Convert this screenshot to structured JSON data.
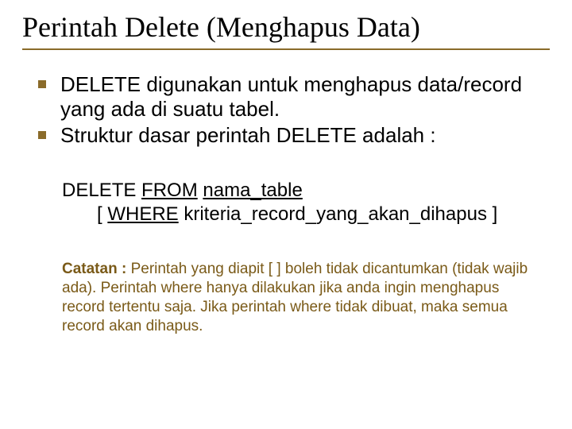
{
  "title": "Perintah Delete (Menghapus Data)",
  "bullets": [
    "DELETE digunakan untuk menghapus data/record yang ada di suatu tabel.",
    "Struktur dasar perintah DELETE adalah :"
  ],
  "syntax": {
    "kw_delete": "DELETE",
    "kw_from": "FROM",
    "table_placeholder": "nama_table",
    "bracket_open": "[",
    "kw_where": "WHERE",
    "criteria_placeholder": "kriteria_record_yang_akan_dihapus",
    "bracket_close": "]"
  },
  "note": {
    "label": "Catatan :",
    "body_part1": " Perintah yang diapit [ ] boleh tidak dicantumkan (tidak wajib ada). Perintah where hanya dilakukan jika anda ingin menghapus record tertentu saja. ",
    "body_emph": "Jika perintah where tidak dibuat, maka semua record akan dihapus."
  },
  "colors": {
    "accent": "#8a6b2a",
    "note_text": "#7a5a18"
  }
}
